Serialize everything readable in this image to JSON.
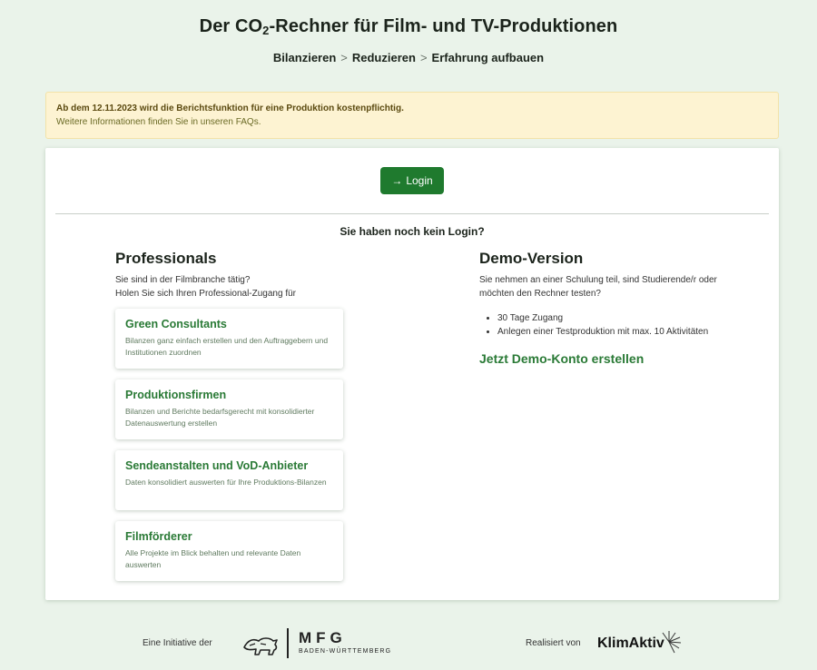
{
  "header": {
    "title_pre": "Der CO",
    "title_sub": "2",
    "title_post": "-Rechner für Film- und TV-Produktionen",
    "breadcrumbs": [
      "Bilanzieren",
      "Reduzieren",
      "Erfahrung aufbauen"
    ],
    "separator": ">"
  },
  "notice": {
    "line1": "Ab dem 12.11.2023 wird die Berichtsfunktion für eine Produktion kostenpflichtig.",
    "line2": "Weitere Informationen finden Sie in unseren FAQs."
  },
  "login": {
    "arrow": "→",
    "label": "Login",
    "no_login_text": "Sie haben noch kein Login?"
  },
  "professionals": {
    "heading": "Professionals",
    "intro_line1": "Sie sind in der Filmbranche tätig?",
    "intro_line2": "Holen Sie sich Ihren Professional-Zugang für",
    "tiles": [
      {
        "title": "Green Consultants",
        "desc": "Bilanzen ganz einfach erstellen und den Auftraggebern und Institutionen zuordnen"
      },
      {
        "title": "Produktionsfirmen",
        "desc": "Bilanzen und Berichte bedarfsgerecht mit konsolidierter Datenauswertung erstellen"
      },
      {
        "title": "Sendeanstalten und VoD-Anbieter",
        "desc": "Daten konsolidiert auswerten für Ihre Produktions-Bilanzen"
      },
      {
        "title": "Filmförderer",
        "desc": "Alle Projekte im Blick behalten und relevante Daten auswerten"
      }
    ]
  },
  "demo": {
    "heading": "Demo-Version",
    "intro": "Sie nehmen an einer Schulung teil, sind Studierende/r oder möchten den Rechner testen?",
    "bullets": [
      "30 Tage Zugang",
      "Anlegen einer Testproduktion mit max. 10 Aktivitäten"
    ],
    "link": "Jetzt Demo-Konto erstellen"
  },
  "footer": {
    "initiative_text": "Eine Initiative der",
    "mfg_main": "MFG",
    "mfg_sub": "BADEN-WÜRTTEMBERG",
    "realized_text": "Realisiert von",
    "klimaktiv": "KlimAktiv"
  },
  "colors": {
    "page_bg": "#eaf3ea",
    "accent_green": "#1f7a2e",
    "notice_bg": "#fdf3d2"
  }
}
